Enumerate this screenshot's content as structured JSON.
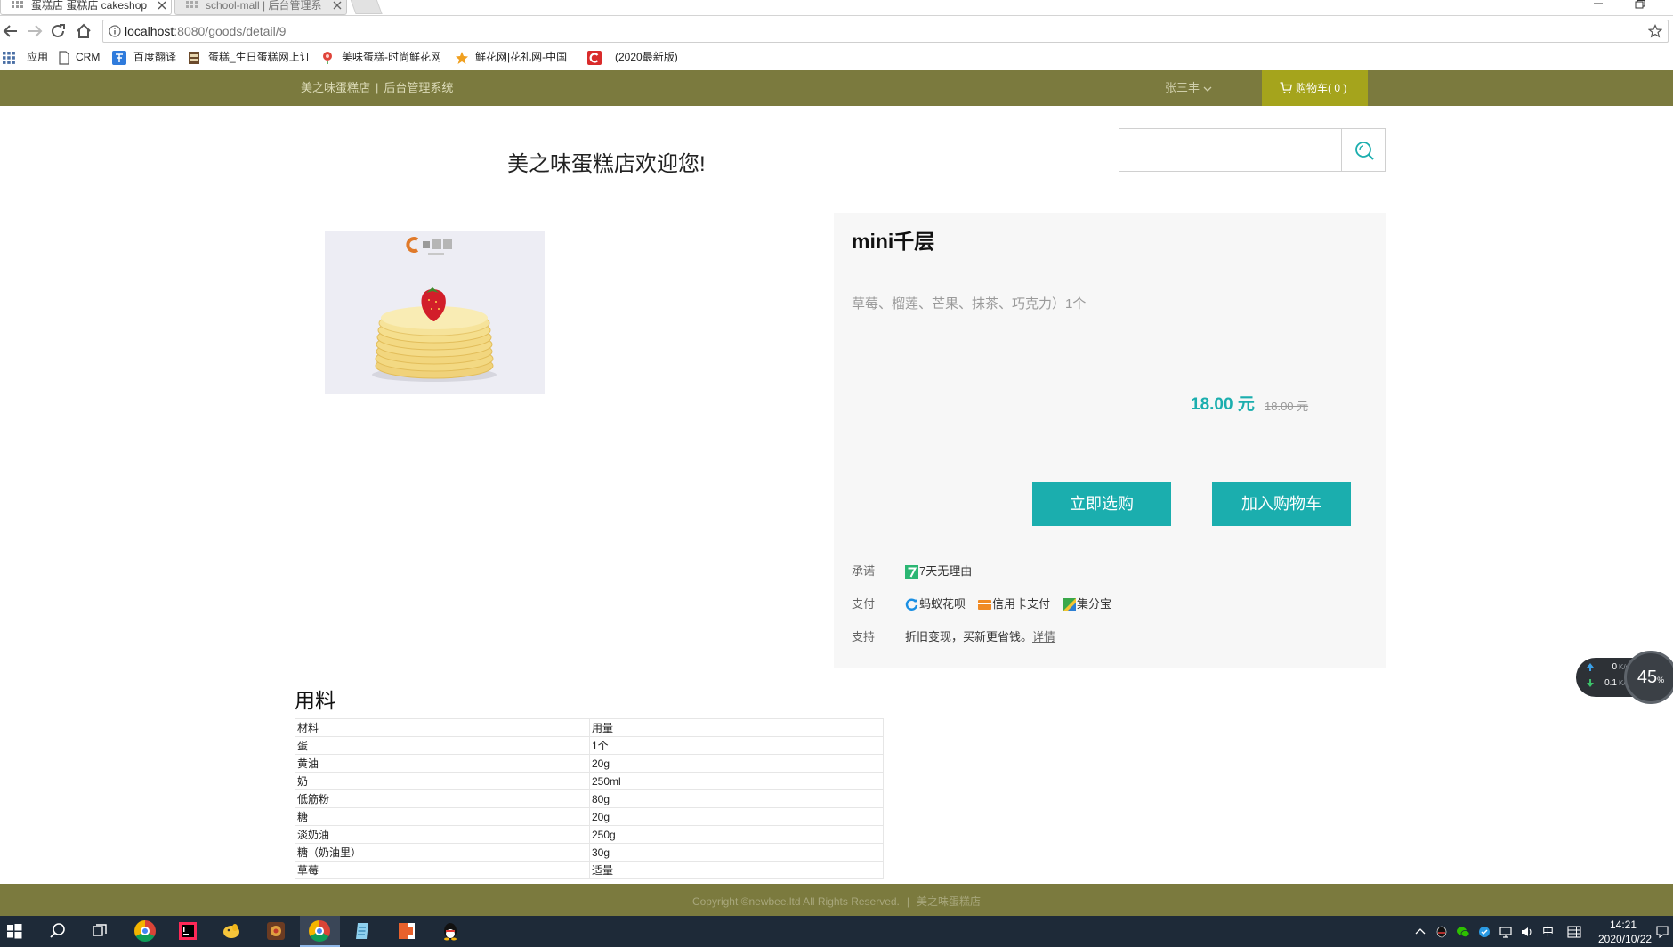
{
  "browser": {
    "tabs": [
      {
        "label": "蛋糕店 蛋糕店 cakeshop",
        "active": true
      },
      {
        "label": "school-mall | 后台管理系",
        "active": false
      }
    ],
    "url_host": "localhost",
    "url_path": ":8080/goods/detail/9",
    "bookmarks": [
      {
        "label": "应用",
        "icon": "apps-grid-icon"
      },
      {
        "label": "CRM",
        "icon": "page-icon"
      },
      {
        "label": "百度翻译",
        "icon": "translate-icon"
      },
      {
        "label": "蛋糕_生日蛋糕网上订",
        "icon": "cake-site-icon"
      },
      {
        "label": "美味蛋糕-时尚鲜花网",
        "icon": "flower-icon"
      },
      {
        "label": "鲜花网|花礼网-中国",
        "icon": "flower-star-icon"
      },
      {
        "label": "(2020最新版)",
        "icon": "c-logo-icon"
      }
    ]
  },
  "header": {
    "brand": "美之味蛋糕店",
    "separator": "|",
    "admin_link": "后台管理系统",
    "user_name": "张三丰",
    "cart_label": "购物车( 0 )"
  },
  "welcome": "美之味蛋糕店欢迎您!",
  "search": {
    "value": ""
  },
  "product": {
    "name": "mini千层",
    "description": "草莓、榴莲、芒果、抹茶、巧克力）1个",
    "price": "18.00 元",
    "original_price": "18.00 元",
    "buy_now_label": "立即选购",
    "add_to_cart_label": "加入购物车",
    "services": {
      "promise_label": "承诺",
      "promise_value": "7天无理由",
      "payment_label": "支付",
      "payment_methods": [
        "蚂蚁花呗",
        "信用卡支付",
        "集分宝"
      ],
      "support_label": "支持",
      "support_text": "折旧变现，买新更省钱。",
      "support_link": "详情"
    }
  },
  "ingredients": {
    "title": "用料",
    "columns": [
      "材料",
      "用量"
    ],
    "rows": [
      [
        "蛋",
        "1个"
      ],
      [
        "黄油",
        "20g"
      ],
      [
        "奶",
        "250ml"
      ],
      [
        "低筋粉",
        "80g"
      ],
      [
        "糖",
        "20g"
      ],
      [
        "淡奶油",
        "250g"
      ],
      [
        "糖（奶油里）",
        "30g"
      ],
      [
        "草莓",
        "适量"
      ]
    ]
  },
  "footer": {
    "copyright": "Copyright ©newbee.ltd All Rights Reserved.",
    "separator": "|",
    "shop": "美之味蛋糕店"
  },
  "taskbar": {
    "ime": "中",
    "time": "14:21",
    "date": "2020/10/22"
  },
  "net_monitor": {
    "upload": "0",
    "upload_unit": "K/s",
    "download": "0.1",
    "download_unit": "K/s",
    "usage": "45",
    "usage_unit": "%"
  },
  "colors": {
    "header_bg": "#7b7a3e",
    "cart_bg": "#a5a41c",
    "accent": "#1baeae",
    "panel_bg": "#f7f7f7",
    "taskbar_bg": "#1e2a38"
  }
}
